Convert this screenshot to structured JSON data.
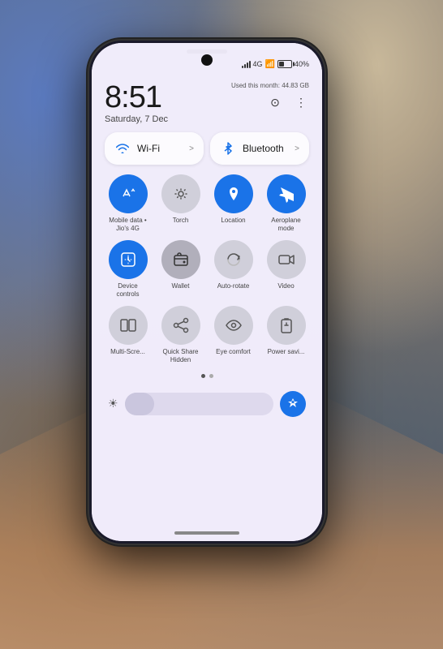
{
  "scene": {
    "bg_color": "#2a2a2a"
  },
  "status_bar": {
    "battery_percent": "40%",
    "signal_label": "signal"
  },
  "panel": {
    "time": "8:51",
    "date": "Saturday, 7 Dec",
    "data_usage": "Used this month: 44.83 GB",
    "wifi_label": "Wi-Fi",
    "wifi_arrow": ">",
    "bluetooth_label": "Bluetooth",
    "bluetooth_arrow": ">"
  },
  "controls": {
    "row1": [
      {
        "id": "mobile-data",
        "label": "Mobile data •\nJio's 4G",
        "state": "active",
        "icon": "↑↓"
      },
      {
        "id": "torch",
        "label": "Torch",
        "state": "inactive",
        "icon": "🔦"
      },
      {
        "id": "location",
        "label": "Location",
        "state": "active",
        "icon": "📍"
      },
      {
        "id": "aeroplane",
        "label": "Aeroplane\nmode",
        "state": "active",
        "icon": "✈"
      }
    ],
    "row2": [
      {
        "id": "device-controls",
        "label": "Device\ncontrols",
        "state": "active",
        "icon": "🏠"
      },
      {
        "id": "wallet",
        "label": "Wallet",
        "state": "semi",
        "icon": "💳"
      },
      {
        "id": "auto-rotate",
        "label": "Auto-rotate",
        "state": "inactive",
        "icon": "🔄"
      },
      {
        "id": "video",
        "label": "Video",
        "state": "inactive",
        "icon": "🎬"
      }
    ],
    "row3": [
      {
        "id": "multi-screen",
        "label": "Multi-Scre...",
        "state": "inactive",
        "icon": "⊞"
      },
      {
        "id": "quick-share",
        "label": "Quick Share\nHidden",
        "state": "inactive",
        "icon": "↗"
      },
      {
        "id": "eye-comfort",
        "label": "Eye comfort",
        "state": "inactive",
        "icon": "👁"
      },
      {
        "id": "power-save",
        "label": "Power savi...",
        "state": "inactive",
        "icon": "⚡"
      }
    ]
  },
  "brightness": {
    "sun_icon": "☀",
    "star_icon": "✦"
  },
  "dots": {
    "count": 2,
    "active_index": 0
  }
}
